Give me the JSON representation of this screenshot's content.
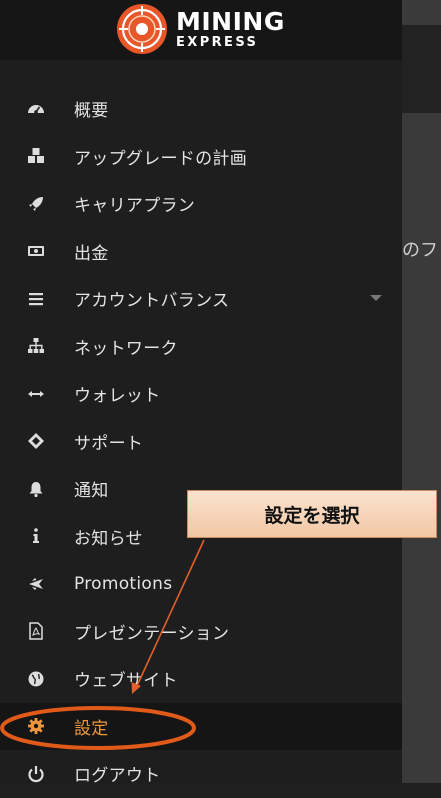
{
  "background": {
    "partial_text": "のフ"
  },
  "logo": {
    "line1": "MINING",
    "line2": "EXPRESS"
  },
  "menu": {
    "items": [
      {
        "label": "概要",
        "icon": "dashboard-icon"
      },
      {
        "label": "アップグレードの計画",
        "icon": "cubes-icon"
      },
      {
        "label": "キャリアプラン",
        "icon": "rocket-icon"
      },
      {
        "label": "出金",
        "icon": "money-icon"
      },
      {
        "label": "アカウントバランス",
        "icon": "bars-icon"
      },
      {
        "label": "ネットワーク",
        "icon": "sitemap-icon"
      },
      {
        "label": "ウォレット",
        "icon": "arrows-h-icon"
      },
      {
        "label": "サポート",
        "icon": "ticket-icon"
      },
      {
        "label": "通知",
        "icon": "bell-icon"
      },
      {
        "label": "お知らせ",
        "icon": "info-icon"
      },
      {
        "label": "Promotions",
        "icon": "plane-icon"
      },
      {
        "label": "プレゼンテーション",
        "icon": "file-pdf-icon"
      },
      {
        "label": "ウェブサイト",
        "icon": "globe-icon"
      },
      {
        "label": "設定",
        "icon": "gear-icon"
      },
      {
        "label": "ログアウト",
        "icon": "power-icon"
      }
    ]
  },
  "annotation": {
    "callout_text": "設定を選択"
  },
  "colors": {
    "accent": "#f0963a",
    "highlight_ring": "#e05a1a",
    "sidebar_bg": "#1e1e1e"
  }
}
